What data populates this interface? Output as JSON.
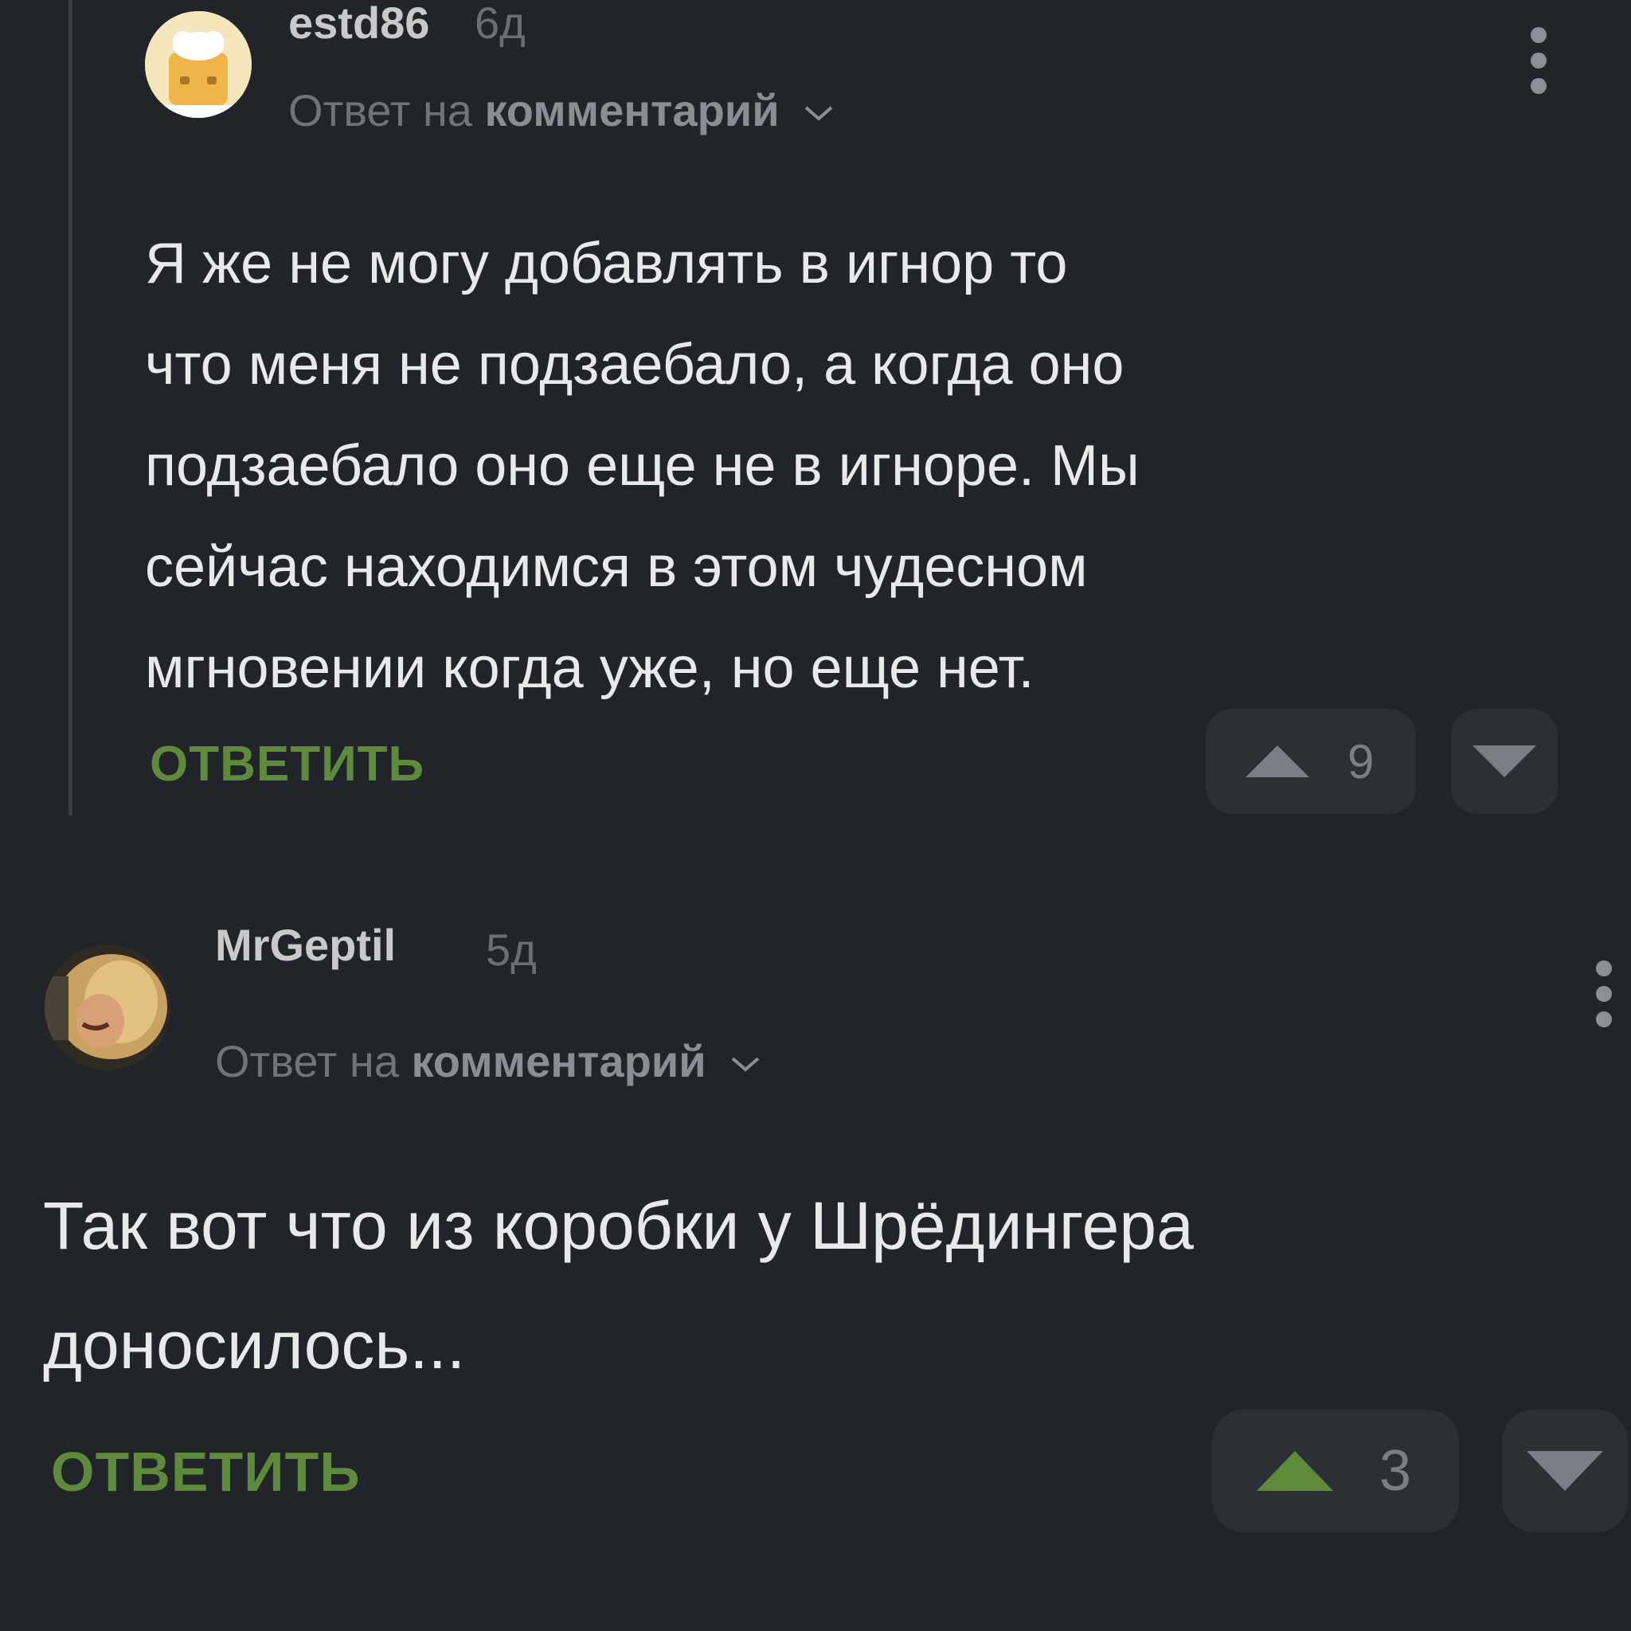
{
  "comments": [
    {
      "username": "estd86",
      "age": "6д",
      "reply_prefix": "Ответ на",
      "reply_link": "комментарий",
      "text_lines": [
        "Я же не могу добавлять в игнор то",
        "что меня не подзаебало, а когда оно",
        "подзаебало оно еще не в игноре. Мы",
        "сейчас находимся в этом чудесном",
        "мгновении когда уже, но еще нет."
      ],
      "reply_button": "ОТВЕТИТЬ",
      "rating": "9",
      "upvoted": false
    },
    {
      "username": "MrGeptil",
      "age": "5д",
      "reply_prefix": "Ответ на",
      "reply_link": "комментарий",
      "text_lines": [
        "Так вот что из коробки у Шрёдингера",
        "доносилось..."
      ],
      "reply_button": "ОТВЕТИТЬ",
      "rating": "3",
      "upvoted": true
    }
  ],
  "colors": {
    "background": "#212428",
    "accent_green": "#5e8a3c",
    "upvote_active": "#5e8a3c",
    "vote_icon_inactive": "#7b7f85"
  },
  "icons": {
    "kebab": "more-vertical-icon",
    "chevron": "chevron-down-icon",
    "upvote": "triangle-up-icon",
    "downvote": "triangle-down-icon"
  }
}
